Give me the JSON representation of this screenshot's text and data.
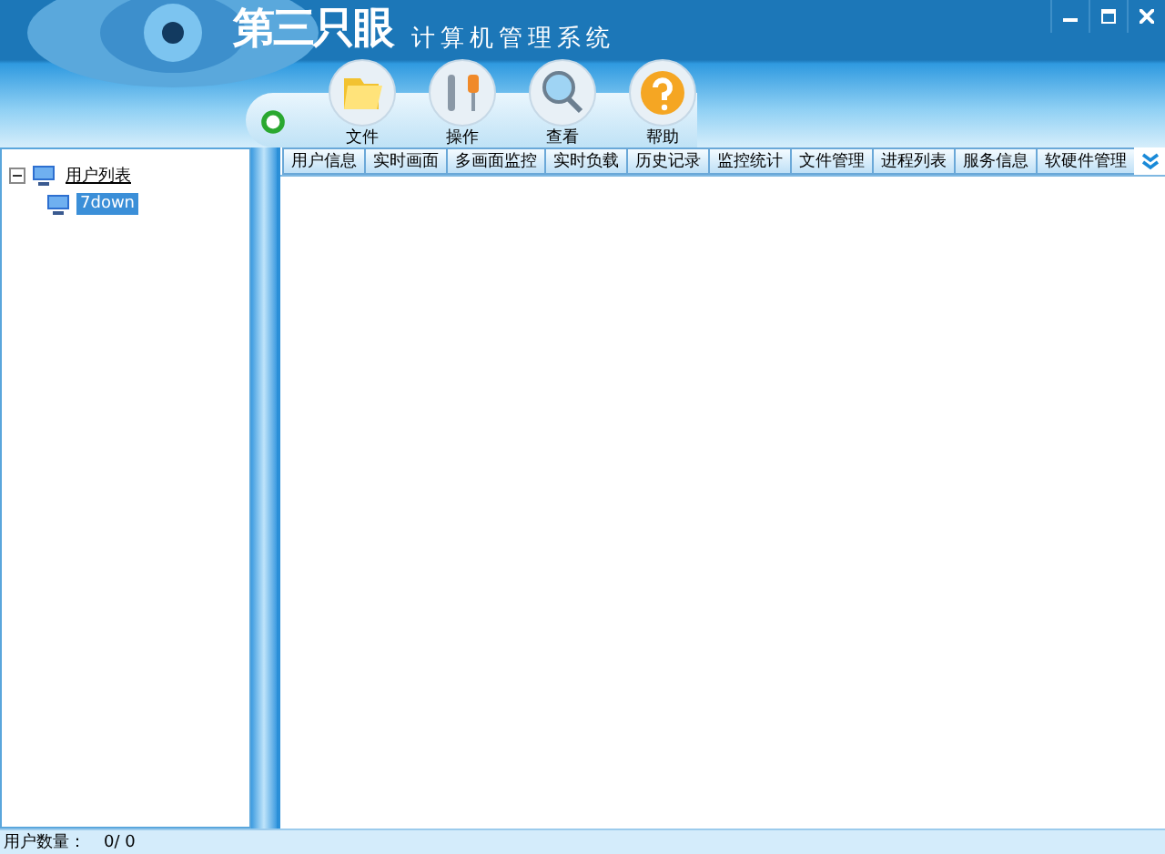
{
  "window": {
    "logo": "第三只眼",
    "title": "计算机管理系统"
  },
  "toolbar": [
    {
      "label": "文件",
      "kind": "folder"
    },
    {
      "label": "操作",
      "kind": "tools"
    },
    {
      "label": "查看",
      "kind": "search"
    },
    {
      "label": "帮助",
      "kind": "help"
    }
  ],
  "tree": {
    "items": [
      {
        "label": "用户列表",
        "expanded": true,
        "selected": false,
        "children": [
          {
            "label": "7down",
            "selected": true
          }
        ]
      }
    ]
  },
  "tabs": [
    {
      "label": "用户信息"
    },
    {
      "label": "实时画面"
    },
    {
      "label": "多画面监控"
    },
    {
      "label": "实时负载"
    },
    {
      "label": "历史记录"
    },
    {
      "label": "监控统计"
    },
    {
      "label": "文件管理"
    },
    {
      "label": "进程列表"
    },
    {
      "label": "服务信息"
    },
    {
      "label": "软硬件管理"
    }
  ],
  "status_bar": {
    "label": "用户数量：",
    "value": "0/ 0"
  }
}
